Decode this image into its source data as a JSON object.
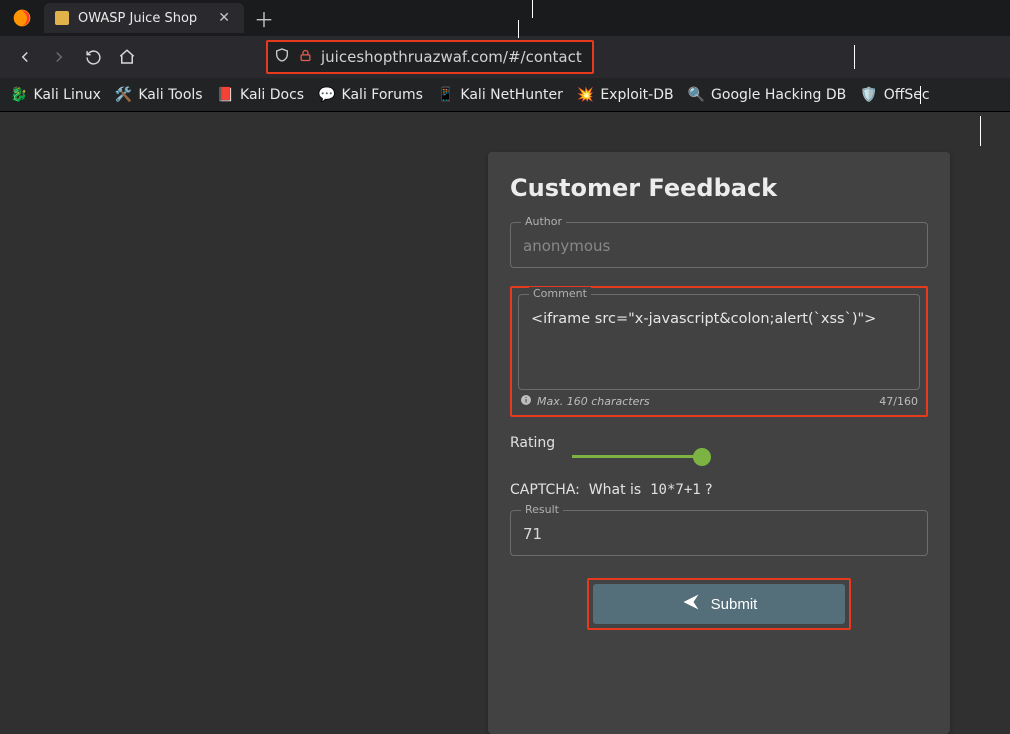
{
  "browser": {
    "tab_title": "OWASP Juice Shop",
    "url": "juiceshopthruazwaf.com/#/contact"
  },
  "bookmarks": [
    {
      "label": "Kali Linux",
      "icon": "🐉"
    },
    {
      "label": "Kali Tools",
      "icon": "🛠️"
    },
    {
      "label": "Kali Docs",
      "icon": "📕"
    },
    {
      "label": "Kali Forums",
      "icon": "💬"
    },
    {
      "label": "Kali NetHunter",
      "icon": "📱"
    },
    {
      "label": "Exploit-DB",
      "icon": "💥"
    },
    {
      "label": "Google Hacking DB",
      "icon": "🔍"
    },
    {
      "label": "OffSec",
      "icon": "🛡️"
    }
  ],
  "feedback": {
    "title": "Customer Feedback",
    "author_label": "Author",
    "author_value": "anonymous",
    "comment_label": "Comment",
    "comment_value": "<iframe src=\"x-javascript&colon;alert(`xss`)\">",
    "max_hint": "Max. 160 characters",
    "char_count": "47/160",
    "rating_label": "Rating",
    "captcha_label": "CAPTCHA:",
    "captcha_prompt": "What is",
    "captcha_expression": "10*7+1",
    "captcha_suffix": "?",
    "result_label": "Result",
    "result_value": "71",
    "submit_label": "Submit"
  },
  "colors": {
    "highlight": "#e63a1e",
    "slider": "#7cb342",
    "card": "#424242"
  }
}
